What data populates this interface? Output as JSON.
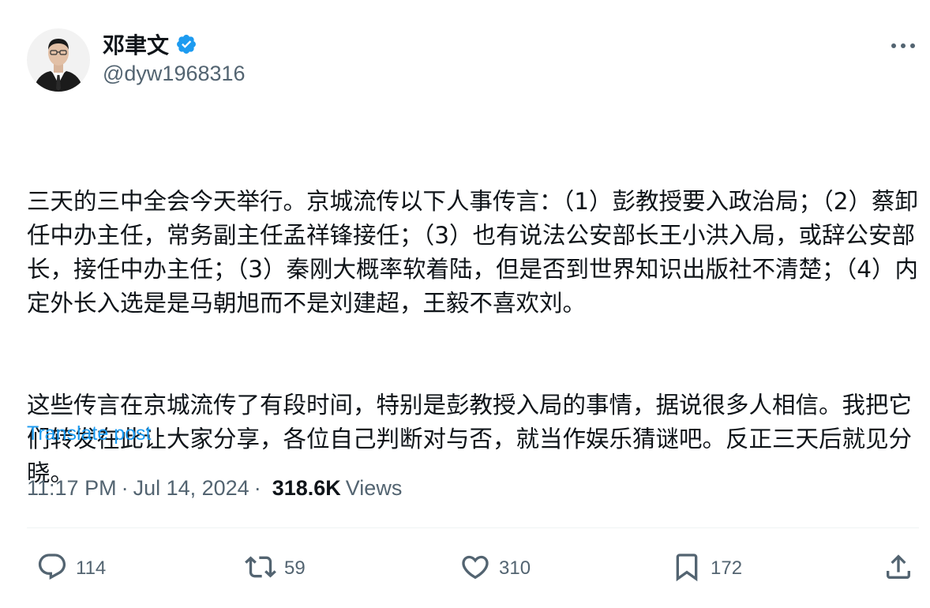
{
  "author": {
    "name": "邓聿文",
    "handle": "@dyw1968316",
    "verified": true
  },
  "tweet": {
    "paragraphs": [
      "三天的三中全会今天举行。京城流传以下人事传言：（1）彭教授要入政治局；（2）蔡卸任中办主任，常务副主任孟祥锋接任；（3）也有说法公安部长王小洪入局，或辞公安部长，接任中办主任；（3）秦刚大概率软着陆，但是否到世界知识出版社不清楚；（4）内定外长入选是是马朝旭而不是刘建超，王毅不喜欢刘。",
      "这些传言在京城流传了有段时间，特别是彭教授入局的事情，据说很多人相信。我把它们转发在此让大家分享，各位自己判断对与否，就当作娱乐猜谜吧。反正三天后就见分晓。"
    ],
    "translate_label": "Translate post",
    "time": "11:17 PM",
    "separator": "·",
    "date": "Jul 14, 2024",
    "views_count": "318.6K",
    "views_label": "Views"
  },
  "actions": {
    "replies": "114",
    "reposts": "59",
    "likes": "310",
    "bookmarks": "172"
  },
  "icons": {
    "more": "more-horizontal-icon",
    "verified": "verified-badge-icon",
    "reply": "reply-icon",
    "repost": "repost-icon",
    "like": "heart-icon",
    "bookmark": "bookmark-icon",
    "share": "share-icon"
  },
  "colors": {
    "accent": "#1d9bf0",
    "secondary_text": "#536471",
    "primary_text": "#0f1419",
    "divider": "#eff3f4"
  }
}
